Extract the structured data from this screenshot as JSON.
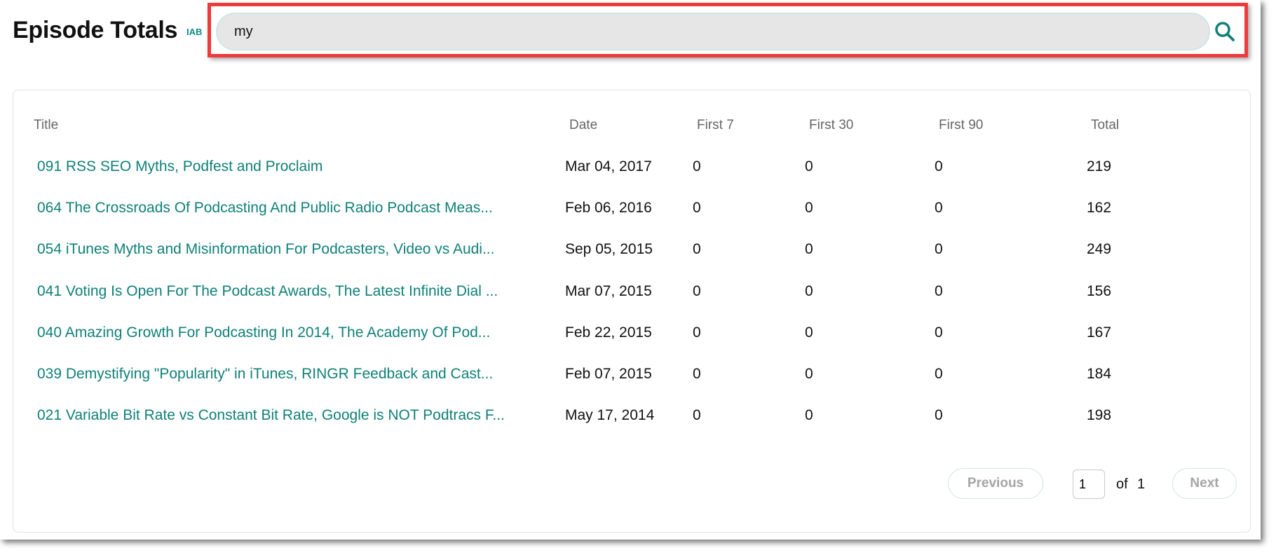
{
  "header": {
    "title": "Episode Totals",
    "badge": "IAB"
  },
  "search": {
    "value": "my",
    "icon": "search-icon"
  },
  "table": {
    "columns": [
      "Title",
      "Date",
      "First 7",
      "First 30",
      "First 90",
      "Total"
    ],
    "rows": [
      {
        "title": "091 RSS SEO Myths, Podfest and Proclaim",
        "date": "Mar 04, 2017",
        "first7": "0",
        "first30": "0",
        "first90": "0",
        "total": "219"
      },
      {
        "title": "064 The Crossroads Of Podcasting And Public Radio Podcast Meas...",
        "date": "Feb 06, 2016",
        "first7": "0",
        "first30": "0",
        "first90": "0",
        "total": "162"
      },
      {
        "title": "054 iTunes Myths and Misinformation For Podcasters, Video vs Audi...",
        "date": "Sep 05, 2015",
        "first7": "0",
        "first30": "0",
        "first90": "0",
        "total": "249"
      },
      {
        "title": "041 Voting Is Open For The Podcast Awards, The Latest Infinite Dial ...",
        "date": "Mar 07, 2015",
        "first7": "0",
        "first30": "0",
        "first90": "0",
        "total": "156"
      },
      {
        "title": "040 Amazing Growth For Podcasting In 2014, The Academy Of Pod...",
        "date": "Feb 22, 2015",
        "first7": "0",
        "first30": "0",
        "first90": "0",
        "total": "167"
      },
      {
        "title": "039 Demystifying \"Popularity\" in iTunes, RINGR Feedback and Cast...",
        "date": "Feb 07, 2015",
        "first7": "0",
        "first30": "0",
        "first90": "0",
        "total": "184"
      },
      {
        "title": "021 Variable Bit Rate vs Constant Bit Rate, Google is NOT Podtracs F...",
        "date": "May 17, 2014",
        "first7": "0",
        "first30": "0",
        "first90": "0",
        "total": "198"
      }
    ]
  },
  "pagination": {
    "previous_label": "Previous",
    "next_label": "Next",
    "current_page": "1",
    "of_label": "of",
    "total_pages": "1"
  },
  "colors": {
    "accent": "#0f8078",
    "highlight": "#ee3a3a"
  }
}
